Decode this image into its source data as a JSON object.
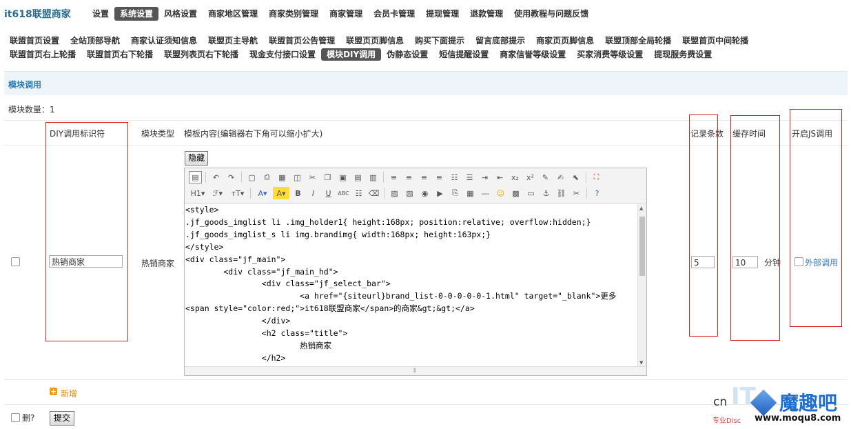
{
  "logo": "it618联盟商家",
  "topnav": [
    "设置",
    "系统设置",
    "风格设置",
    "商家地区管理",
    "商家类别管理",
    "商家管理",
    "会员卡管理",
    "提现管理",
    "退款管理",
    "使用教程与问题反馈"
  ],
  "subnav1": [
    "联盟首页设置",
    "全站顶部导航",
    "商家认证须知信息",
    "联盟页主导航",
    "联盟首页公告管理",
    "联盟页页脚信息",
    "购买下面提示",
    "留言底部提示",
    "商家页页脚信息",
    "联盟顶部全局轮播",
    "联盟首页中间轮播"
  ],
  "subnav2": [
    "联盟首页右上轮播",
    "联盟首页右下轮播",
    "联盟列表页右下轮播",
    "现金支付接口设置",
    "模块DIY调用",
    "伪静态设置",
    "短信提醒设置",
    "商家信誉等级设置",
    "买家消费等级设置",
    "提现服务费设置"
  ],
  "section_title": "模块调用",
  "module_count": "模块数量：1",
  "headers": {
    "diy_id": "DIY调用标识符",
    "type": "模块类型",
    "content": "模板内容(编辑器右下角可以缩小扩大)",
    "records": "记录条数",
    "cache": "缓存时间",
    "js": "开启JS调用"
  },
  "row": {
    "diy_id_value": "热销商家",
    "type": "热销商家",
    "hide_button": "隐藏",
    "records_value": "5",
    "cache_value": "10",
    "cache_unit": "分钟",
    "js_label": "外部调用"
  },
  "code_lines": [
    "<style>",
    ".jf_goods_imglist li .img_holder1{ height:168px; position:relative; overflow:hidden;}",
    ".jf_goods_imglist_s li img.brandimg{ width:168px; height:163px;}",
    "</style>",
    "<div class=\"jf_main\">",
    "        <div class=\"jf_main_hd\">",
    "                <div class=\"jf_select_bar\">",
    "                        <a href=\"{siteurl}brand_list-0-0-0-0-0-1.html\" target=\"_blank\">更多",
    "<span style=\"color:red;\">it618联盟商家</span>的商家&gt;&gt;</a>",
    "                </div>",
    "                <h2 class=\"title\">",
    "                        热销商家",
    "                </h2>"
  ],
  "add_label": "新增",
  "delete_label": "删?",
  "submit_label": "提交",
  "watermark": {
    "brand": "魔趣吧",
    "url": "www.moqu8.com",
    "prefix": "cn",
    "tag": "专业Disc"
  },
  "colors": {
    "accent": "#2b7cb3",
    "active_tab": "#555555",
    "red_box": "#d02020"
  }
}
